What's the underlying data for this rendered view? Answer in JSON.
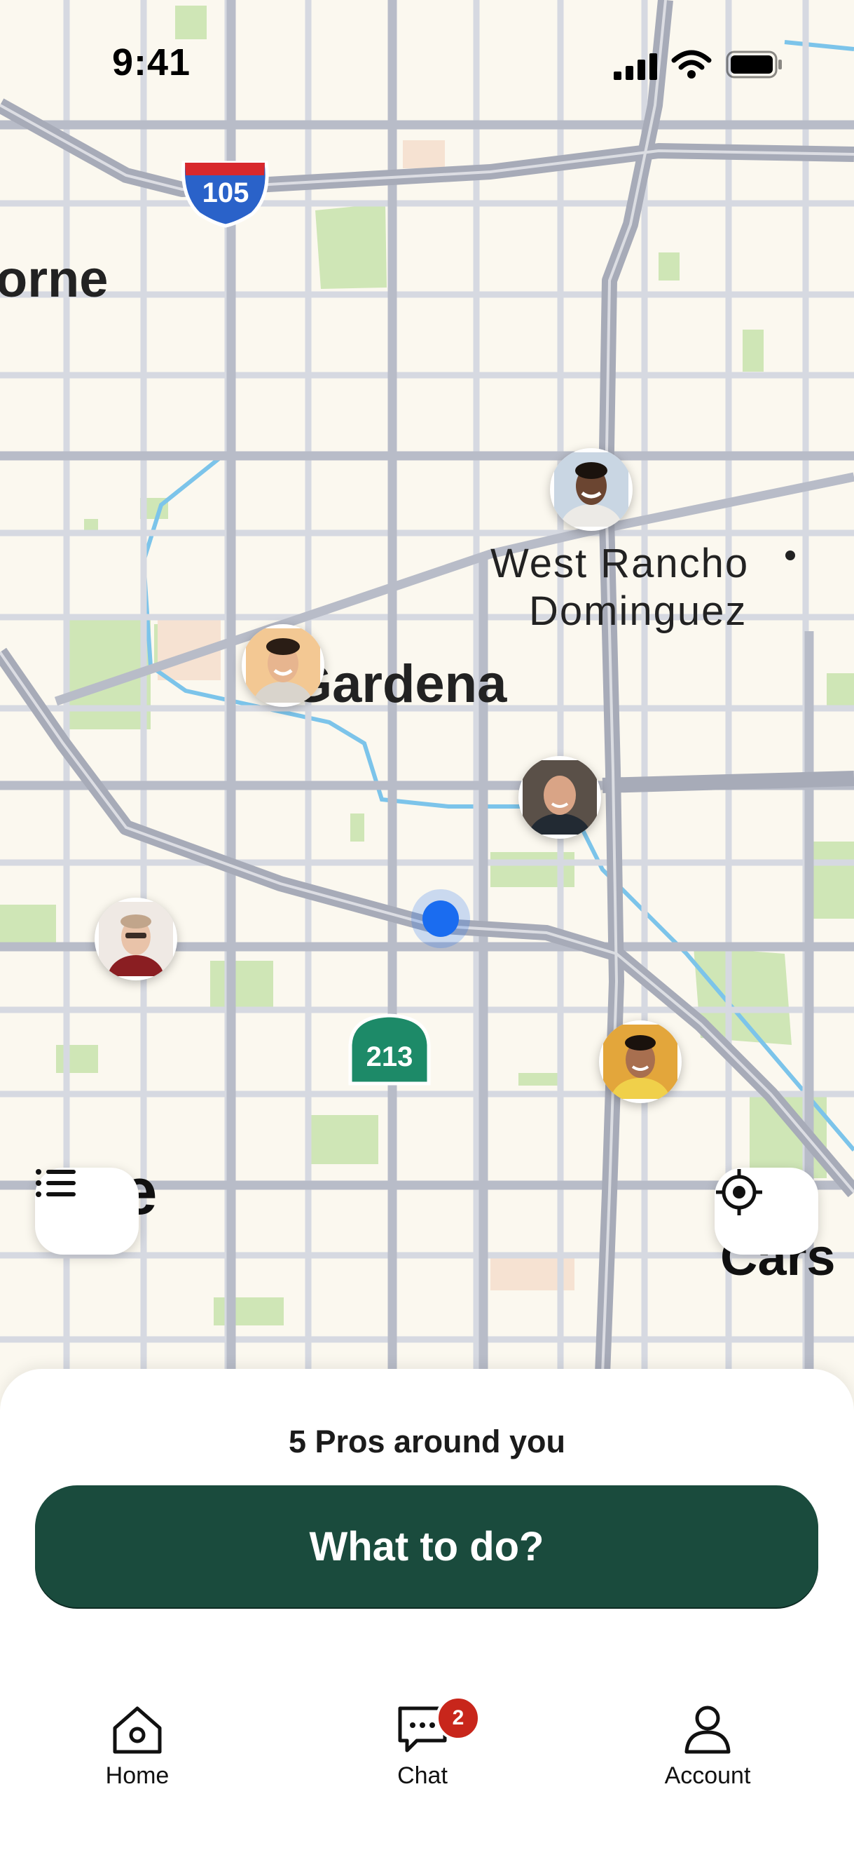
{
  "status_bar": {
    "time": "9:41"
  },
  "map": {
    "places": {
      "city_top_left": "orne",
      "west_rancho": "West Rancho",
      "dominguez": "Dominguez",
      "gardena": "Gardena",
      "city_bottom_left": "ce",
      "city_bottom_right": "Cars"
    },
    "route_shields": {
      "interstate": "105",
      "state_route": "213"
    },
    "pros": [
      {
        "name": "pro-1"
      },
      {
        "name": "pro-2"
      },
      {
        "name": "pro-3"
      },
      {
        "name": "pro-4"
      },
      {
        "name": "pro-5"
      }
    ]
  },
  "sheet": {
    "pros_count": "5 Pros around you",
    "cta_label": "What to do?"
  },
  "tab_bar": {
    "home": "Home",
    "chat": "Chat",
    "chat_badge": "2",
    "account": "Account"
  },
  "colors": {
    "brand": "#1a4b3d",
    "user_location": "#1a6cf0",
    "badge": "#c8261b"
  }
}
